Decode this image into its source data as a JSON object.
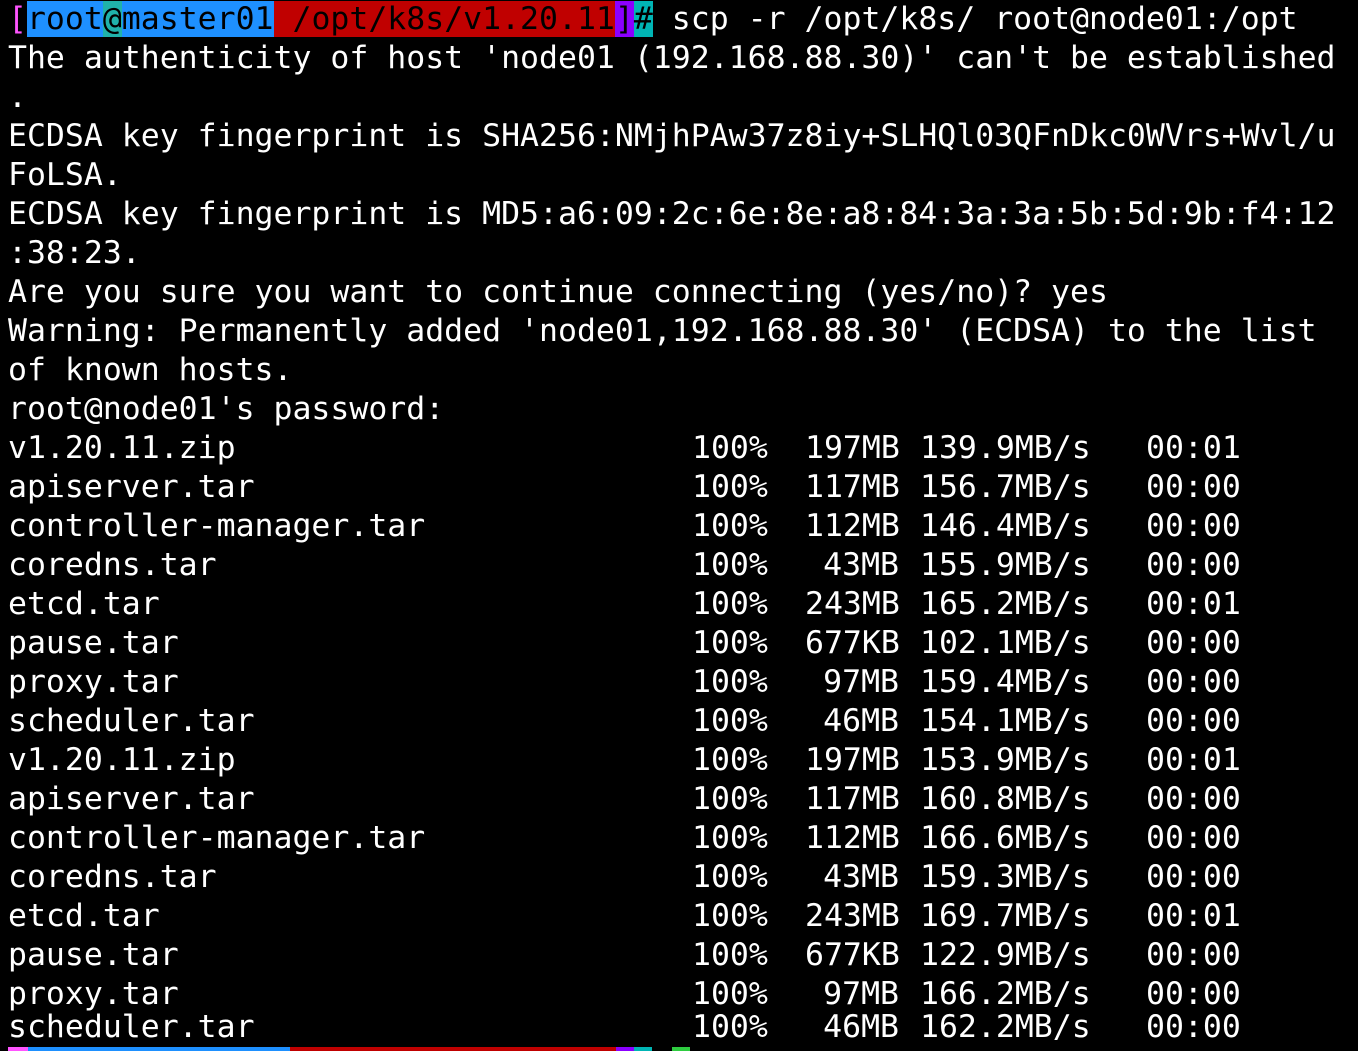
{
  "prompt": {
    "bracket_open": "[",
    "user": "root",
    "at": "@",
    "host": "master01",
    "space": " ",
    "path": "/opt/k8s/v1.20.11",
    "bracket_close": "]",
    "hash": "#",
    "command": " scp -r /opt/k8s/ root@node01:/opt"
  },
  "output_lines": [
    "The authenticity of host 'node01 (192.168.88.30)' can't be established",
    ".",
    "ECDSA key fingerprint is SHA256:NMjhPAw37z8iy+SLHQl03QFnDkc0WVrs+Wvl/u",
    "FoLSA.",
    "ECDSA key fingerprint is MD5:a6:09:2c:6e:8e:a8:84:3a:3a:5b:5d:9b:f4:12",
    ":38:23.",
    "Are you sure you want to continue connecting (yes/no)? yes",
    "Warning: Permanently added 'node01,192.168.88.30' (ECDSA) to the list",
    "of known hosts.",
    "root@node01's password:"
  ],
  "transfers": [
    {
      "name": "v1.20.11.zip",
      "percent": "100%",
      "size": "197MB",
      "rate": "139.9MB/s",
      "time": "00:01"
    },
    {
      "name": "apiserver.tar",
      "percent": "100%",
      "size": "117MB",
      "rate": "156.7MB/s",
      "time": "00:00"
    },
    {
      "name": "controller-manager.tar",
      "percent": "100%",
      "size": "112MB",
      "rate": "146.4MB/s",
      "time": "00:00"
    },
    {
      "name": "coredns.tar",
      "percent": "100%",
      "size": "43MB",
      "rate": "155.9MB/s",
      "time": "00:00"
    },
    {
      "name": "etcd.tar",
      "percent": "100%",
      "size": "243MB",
      "rate": "165.2MB/s",
      "time": "00:01"
    },
    {
      "name": "pause.tar",
      "percent": "100%",
      "size": "677KB",
      "rate": "102.1MB/s",
      "time": "00:00"
    },
    {
      "name": "proxy.tar",
      "percent": "100%",
      "size": "97MB",
      "rate": "159.4MB/s",
      "time": "00:00"
    },
    {
      "name": "scheduler.tar",
      "percent": "100%",
      "size": "46MB",
      "rate": "154.1MB/s",
      "time": "00:00"
    },
    {
      "name": "v1.20.11.zip",
      "percent": "100%",
      "size": "197MB",
      "rate": "153.9MB/s",
      "time": "00:01"
    },
    {
      "name": "apiserver.tar",
      "percent": "100%",
      "size": "117MB",
      "rate": "160.8MB/s",
      "time": "00:00"
    },
    {
      "name": "controller-manager.tar",
      "percent": "100%",
      "size": "112MB",
      "rate": "166.6MB/s",
      "time": "00:00"
    },
    {
      "name": "coredns.tar",
      "percent": "100%",
      "size": "43MB",
      "rate": "159.3MB/s",
      "time": "00:00"
    },
    {
      "name": "etcd.tar",
      "percent": "100%",
      "size": "243MB",
      "rate": "169.7MB/s",
      "time": "00:01"
    },
    {
      "name": "pause.tar",
      "percent": "100%",
      "size": "677KB",
      "rate": "122.9MB/s",
      "time": "00:00"
    },
    {
      "name": "proxy.tar",
      "percent": "100%",
      "size": "97MB",
      "rate": "166.2MB/s",
      "time": "00:00"
    },
    {
      "name": "scheduler.tar",
      "percent": "100%",
      "size": "46MB",
      "rate": "162.2MB/s",
      "time": "00:00"
    }
  ],
  "colors": {
    "background": "#000000",
    "foreground": "#ffffff",
    "prompt_user_bg": "#1e90ff",
    "prompt_at_bg": "#20b2aa",
    "prompt_path_bg": "#c00000",
    "prompt_bracket_bg": "#8b00ff",
    "prompt_hash_bg": "#00b5b5"
  }
}
